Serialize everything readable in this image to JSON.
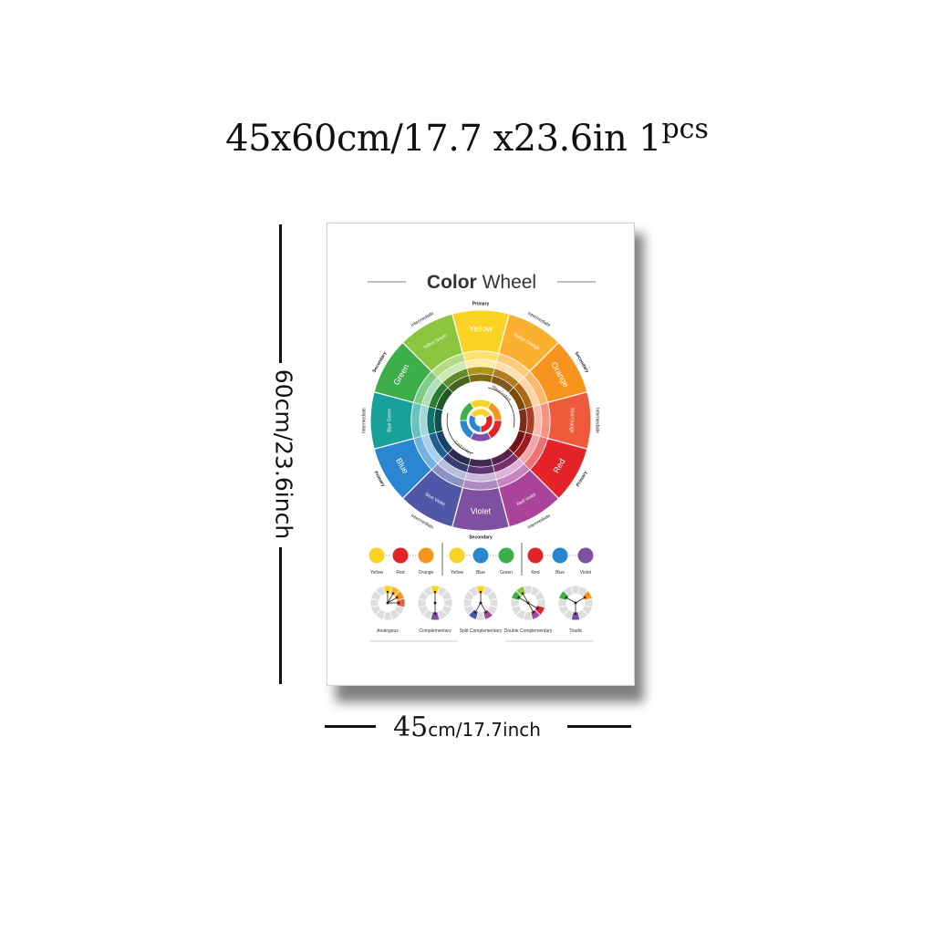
{
  "heading": {
    "size": "45x60cm/17.7 x23.6in",
    "qty": "1",
    "pcs": "pcs"
  },
  "dimensions": {
    "height_label": "60cm/23.6inch",
    "width_number": "45",
    "width_unit": "cm/17.7inch"
  },
  "poster": {
    "title_bold": "Color",
    "title_regular": " Wheel",
    "wheel": {
      "segments": [
        {
          "name": "Yellow",
          "color": "#fbd324",
          "type": "Primary"
        },
        {
          "name": "Yellow Orange",
          "color": "#fbb030",
          "type": "Intermediate"
        },
        {
          "name": "Orange",
          "color": "#f7941d",
          "type": "Secondary"
        },
        {
          "name": "Red Orange",
          "color": "#ef5a3a",
          "type": "Intermediate"
        },
        {
          "name": "Red",
          "color": "#e42328",
          "type": "Primary"
        },
        {
          "name": "Red Violet",
          "color": "#a9449a",
          "type": "Intermediate"
        },
        {
          "name": "Violet",
          "color": "#7f4fa1",
          "type": "Secondary"
        },
        {
          "name": "Blue Violet",
          "color": "#5057a6",
          "type": "Intermediate"
        },
        {
          "name": "Blue",
          "color": "#2a87cf",
          "type": "Primary"
        },
        {
          "name": "Blue Green",
          "color": "#17a19b",
          "type": "Intermediate"
        },
        {
          "name": "Green",
          "color": "#3daf4a",
          "type": "Secondary"
        },
        {
          "name": "Yellow Green",
          "color": "#8cc63f",
          "type": "Intermediate"
        }
      ],
      "warm_label": "Warm colors",
      "cool_label": "Cool colors"
    },
    "triads": [
      {
        "items": [
          {
            "label": "Yellow",
            "color": "#fbd324"
          },
          {
            "label": "Red",
            "color": "#e42328"
          },
          {
            "label": "Orange",
            "color": "#f7941d"
          }
        ]
      },
      {
        "items": [
          {
            "label": "Yellow",
            "color": "#fbd324"
          },
          {
            "label": "Blue",
            "color": "#2a87cf"
          },
          {
            "label": "Green",
            "color": "#3daf4a"
          }
        ]
      },
      {
        "items": [
          {
            "label": "Red",
            "color": "#e42328"
          },
          {
            "label": "Blue",
            "color": "#2a87cf"
          },
          {
            "label": "Violet",
            "color": "#7f4fa1"
          }
        ]
      }
    ],
    "harmonies": [
      {
        "label": "Analogous",
        "highlights": [
          {
            "i": 0,
            "color": "#fbd324"
          },
          {
            "i": 1,
            "color": "#fbb030"
          },
          {
            "i": 2,
            "color": "#f7941d"
          },
          {
            "i": 3,
            "color": "#ef5a3a"
          }
        ]
      },
      {
        "label": "Complementary",
        "highlights": [
          {
            "i": 0,
            "color": "#fbd324"
          },
          {
            "i": 6,
            "color": "#7f4fa1"
          }
        ]
      },
      {
        "label": "Split Complementary",
        "highlights": [
          {
            "i": 0,
            "color": "#fbd324"
          },
          {
            "i": 5,
            "color": "#a9449a"
          },
          {
            "i": 7,
            "color": "#5057a6"
          }
        ]
      },
      {
        "label": "Double Complementary",
        "highlights": [
          {
            "i": 10,
            "color": "#3daf4a"
          },
          {
            "i": 11,
            "color": "#8cc63f"
          },
          {
            "i": 4,
            "color": "#e42328"
          },
          {
            "i": 5,
            "color": "#a9449a"
          }
        ]
      },
      {
        "label": "Triadic",
        "highlights": [
          {
            "i": 10,
            "color": "#3daf4a"
          },
          {
            "i": 2,
            "color": "#f7941d"
          },
          {
            "i": 6,
            "color": "#7f4fa1"
          }
        ]
      }
    ]
  }
}
